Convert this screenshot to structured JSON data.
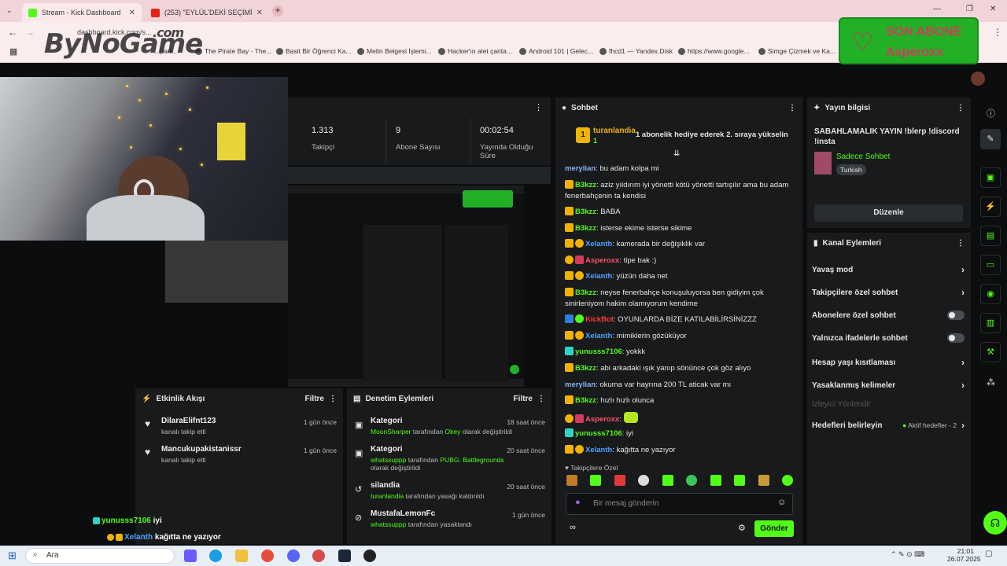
{
  "browser": {
    "tabs": [
      {
        "title": "Stream - Kick Dashboard",
        "icon": "kick-icon",
        "color": "#53fc18"
      },
      {
        "title": "(253) \"EYLÜL'DEKİ SEÇİMİ KİM",
        "icon": "youtube-icon",
        "color": "#e62117"
      }
    ],
    "url": "dashboard.kick.com/s...",
    "bookmarks": [
      "...part...",
      "The Pirate Bay - The...",
      "Basit Bir Öğrenci Ka...",
      "Metin Belgesi İşlemi...",
      "Hacker'ın alet çanta...",
      "Android 101 | Gelec...",
      "fhcd1 — Yandex.Disk",
      "https://www.google...",
      "Simge Çizmek ve Ka..."
    ]
  },
  "watermark": {
    "text": "ByNoGame",
    "suffix": ".com"
  },
  "son_abone": {
    "title": "SON ABONE",
    "name": "Asperoxx",
    "bg": "#22b026",
    "text_color": "#d13c5c"
  },
  "stats": [
    {
      "value": "1.313",
      "label": "Takipçi"
    },
    {
      "value": "9",
      "label": "Abone Sayısı"
    },
    {
      "value": "00:02:54",
      "label": "Yayında Olduğu Süre"
    }
  ],
  "activity": {
    "title": "Etkinlik Akışı",
    "filter": "Filtre",
    "items": [
      {
        "name": "DilaraElifnt123",
        "sub": "kanalı takip etti",
        "time": "1 gün önce"
      },
      {
        "name": "Mancukupakistanissr",
        "sub": "kanalı takip etti",
        "time": "1 gün önce"
      }
    ]
  },
  "moderation": {
    "title": "Denetim Eylemleri",
    "filter": "Filtre",
    "items": [
      {
        "name": "Kategori",
        "actor": "MoonSharper",
        "mid": " tarafından ",
        "val": "Okey",
        "tail": " olarak değiştirildi",
        "time": "18 saat önce"
      },
      {
        "name": "Kategori",
        "actor": "whatssuppp",
        "mid": " tarafından ",
        "val": "PUBG: Battlegrounds",
        "tail": " olarak değiştirildi",
        "time": "20 saat önce"
      },
      {
        "name": "silandia",
        "actor": "turanlandia",
        "mid": " tarafından yasağı kaldırıldı",
        "val": "",
        "tail": "",
        "time": "20 saat önce"
      },
      {
        "name": "MustafaLemonFc",
        "actor": "whatssuppp",
        "mid": " tarafından yasaklandı",
        "val": "",
        "tail": "",
        "time": "1 gün önce"
      }
    ]
  },
  "chat": {
    "title": "Sohbet",
    "pinned_user": "turanlandia",
    "pinned_count": "1",
    "pinned_text": "1 abonelik hediye ederek 2. sıraya yükselin",
    "messages": [
      {
        "user": "merylian",
        "color": "#8ab4f8",
        "text": ": bu adam kolpa mi"
      },
      {
        "user": "B3kzz",
        "color": "#53fc18",
        "text": ": aziz yıldırım iyi yönetti kötü yönetti tartışılır ama bu adam fenerbahçenin ta kendisi"
      },
      {
        "user": "B3kzz",
        "color": "#53fc18",
        "text": ": BABA"
      },
      {
        "user": "B3kzz",
        "color": "#53fc18",
        "text": ": isterse ekime isterse sikime"
      },
      {
        "user": "Xelanth",
        "color": "#4ea3ff",
        "text": ": kamerada bir değişiklik var"
      },
      {
        "user": "Asperoxx",
        "color": "#ff4f6d",
        "text": ": tipe bak :)"
      },
      {
        "user": "Xelanth",
        "color": "#4ea3ff",
        "text": ": yüzün daha net"
      },
      {
        "user": "B3kzz",
        "color": "#53fc18",
        "text": ": neyse fenerbahçe konuşuluyorsa ben gidiyim çok sinirleniyom hakim olamıyorum kendime"
      },
      {
        "user": "KickBot",
        "color": "#ff3b3b",
        "text": ": OYUNLARDA BİZE KATILABİLİRSİNİZZZ"
      },
      {
        "user": "Xelanth",
        "color": "#4ea3ff",
        "text": ": mimiklerin gözüküyor"
      },
      {
        "user": "yunusss7106",
        "color": "#53fc18",
        "text": ": yokkk"
      },
      {
        "user": "B3kzz",
        "color": "#53fc18",
        "text": ": abi arkadaki ışık yanıp sönünce çok göz alıyo"
      },
      {
        "user": "merylian",
        "color": "#8ab4f8",
        "text": ": okuma var hayrına 200 TL aticak var mı"
      },
      {
        "user": "B3kzz",
        "color": "#53fc18",
        "text": ": hızlı hızlı olunca"
      },
      {
        "user": "Asperoxx",
        "color": "#ff4f6d",
        "text": ":"
      },
      {
        "user": "yunusss7106",
        "color": "#53fc18",
        "text": ": iyi"
      },
      {
        "user": "Xelanth",
        "color": "#4ea3ff",
        "text": ": kağıtta ne yazıyor"
      }
    ],
    "followers_only": "Takipçilere Özel",
    "input_placeholder": "Bir mesaj gönderin",
    "send": "Gönder"
  },
  "stream_info": {
    "header": "Yayın bilgisi",
    "title": "SABAHLAMALIK YAYIN !blerp !discord !insta",
    "category": "Sadece Sohbet",
    "tag": "Turkish",
    "edit": "Düzenle"
  },
  "channel_actions": {
    "header": "Kanal Eylemleri",
    "items": [
      {
        "label": "Yavaş mod",
        "kind": "chevron"
      },
      {
        "label": "Takipçilere özel sohbet",
        "kind": "chevron"
      },
      {
        "label": "Abonelere özel sohbet",
        "kind": "toggle"
      },
      {
        "label": "Yalnızca ifadelerle sohbet",
        "kind": "toggle"
      },
      {
        "label": "Hesap yaşı kısıtlaması",
        "kind": "chevron"
      },
      {
        "label": "Yasaklanmış kelimeler",
        "kind": "chevron"
      }
    ],
    "viewer_redirect": "İzleyici Yönlendir",
    "goals": "Hedefleri belirleyin",
    "goals_status": "Aktif hedefler - 2"
  },
  "overlay_chat": [
    {
      "user": "yunusss7106",
      "text": "iyi"
    },
    {
      "user": "Xelanth",
      "text": "kağıtta ne yazıyor"
    }
  ],
  "taskbar": {
    "search": "Ara",
    "time": "21:01",
    "date": "26.07.2025"
  },
  "accent": "#53fc18"
}
